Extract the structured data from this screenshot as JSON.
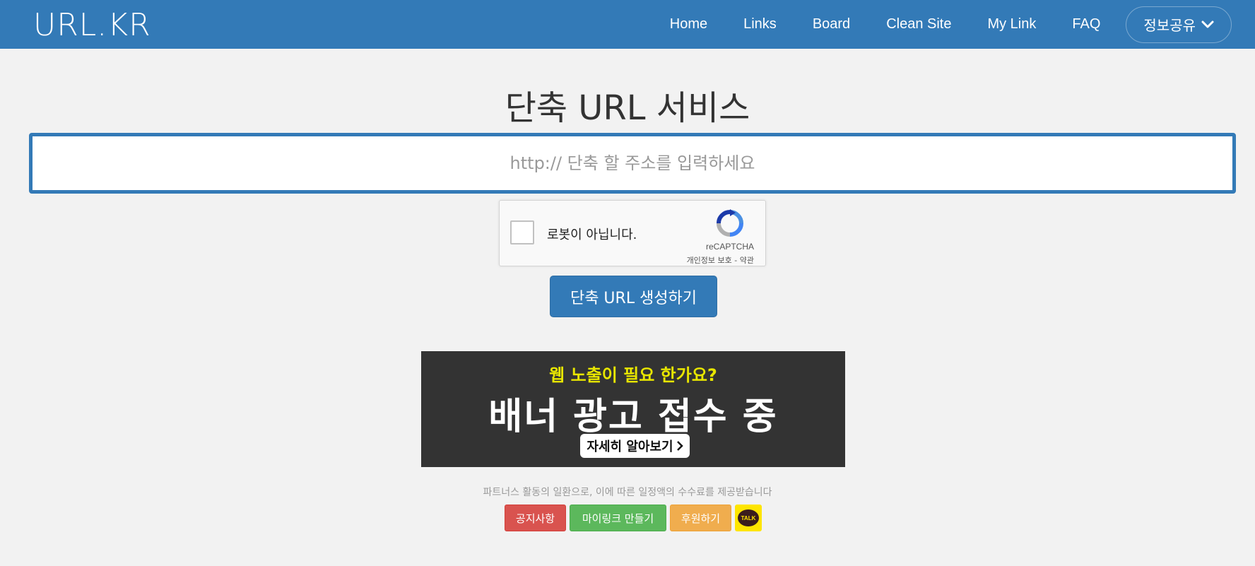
{
  "navbar": {
    "brand": "URL.KR",
    "links": [
      "Home",
      "Links",
      "Board",
      "Clean Site",
      "My Link",
      "FAQ"
    ],
    "dropdown_label": "정보공유"
  },
  "main": {
    "title": "단축 URL 서비스",
    "url_placeholder": "http:// 단축 할 주소를 입력하세요",
    "submit_label": "단축 URL 생성하기"
  },
  "recaptcha": {
    "label": "로봇이 아닙니다.",
    "brand": "reCAPTCHA",
    "privacy": "개인정보 보호",
    "separator": " - ",
    "terms": "약관"
  },
  "banner": {
    "subtitle": "웹 노출이 필요 한가요?",
    "headline": "배너 광고 접수 중",
    "button_label": "자세히 알아보기"
  },
  "footer": {
    "partner_note": "파트너스 활동의 일환으로, 이에 따른 일정액의 수수료를 제공받습니다",
    "notice_label": "공지사항",
    "mylink_label": "마이링크 만들기",
    "donate_label": "후원하기",
    "kakao_label": "TALK"
  },
  "colors": {
    "primary": "#337ab7",
    "danger": "#d9534f",
    "success": "#5cb85c",
    "warning": "#f0ad4e",
    "kakao": "#fee500"
  }
}
